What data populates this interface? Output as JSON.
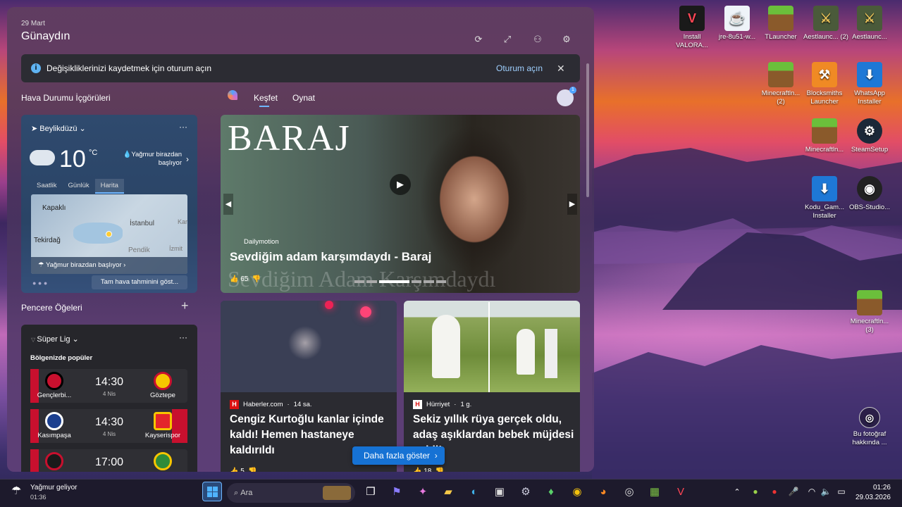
{
  "panel": {
    "date": "29 Mart",
    "greeting": "Günaydın"
  },
  "banner": {
    "message": "Değişikliklerinizi kaydetmek için oturum açın",
    "signin": "Oturum açın"
  },
  "weather": {
    "section_title": "Hava Durumu İçgörüleri",
    "location": "Beylikdüzü",
    "temp": "10",
    "unit": "°C",
    "condition": "Yağmur birazdan başlıyor",
    "tabs": [
      "Saatlik",
      "Günlük",
      "Harita"
    ],
    "map_labels": [
      "Kapaklı",
      "İstanbul",
      "Tekirdağ",
      "Pendik",
      "İzmit",
      "Kar"
    ],
    "map_footer": "Yağmur birazdan başlıyor",
    "full_forecast": "Tam hava tahminini göst..."
  },
  "widgets": {
    "title": "Pencere Öğeleri"
  },
  "league": {
    "name": "Süper Lig",
    "subtitle": "Bölgenizde popüler",
    "matches": [
      {
        "home": "Gençlerbi...",
        "away": "Göztepe",
        "time": "14:30",
        "date": "4 Nis"
      },
      {
        "home": "Kasımpaşa",
        "away": "Kayserispor",
        "time": "14:30",
        "date": "4 Nis"
      },
      {
        "home": "",
        "away": "",
        "time": "17:00",
        "date": ""
      }
    ]
  },
  "feed_tabs": {
    "discover": "Keşfet",
    "play": "Oynat"
  },
  "hero": {
    "overlay_title": "BARAJ",
    "source": "Dailymotion",
    "headline": "Sevdiğim adam karşımdaydı - Baraj",
    "bg_text": "Sevdiğim Adam Karşımdaydı",
    "likes": "65"
  },
  "news": [
    {
      "source": "Haberler.com",
      "time": "14 sa.",
      "headline": "Cengiz Kurtoğlu kanlar içinde kaldı! Hemen hastaneye kaldırıldı",
      "likes": "5"
    },
    {
      "source": "Hürriyet",
      "time": "1 g.",
      "headline": "Sekiz yıllık rüya gerçek oldu, adaş aşıklardan bebek müjdesi geldi!",
      "likes": "18"
    }
  ],
  "more_button": "Daha fazla göster",
  "desktop_icons": [
    {
      "label": "Install VALORA..."
    },
    {
      "label": "jre-8u51-w..."
    },
    {
      "label": "TLauncher"
    },
    {
      "label": "Aestlaunc... (2)"
    },
    {
      "label": "Aestlaunc..."
    },
    {
      "label": "Minecraftln... (2)"
    },
    {
      "label": "Blocksmiths Launcher"
    },
    {
      "label": "WhatsApp Installer"
    },
    {
      "label": "Minecraftln..."
    },
    {
      "label": "SteamSetup"
    },
    {
      "label": "Kodu_Gam... Installer"
    },
    {
      "label": "OBS-Studio..."
    },
    {
      "label": "Minecraftln... (3)"
    },
    {
      "label": "Bu fotoğraf hakkında ..."
    }
  ],
  "taskbar": {
    "weather_title": "Yağmur geliyor",
    "weather_time": "01:36",
    "search_placeholder": "Ara",
    "clock_time": "01:26",
    "clock_date": "29.03.2026"
  }
}
